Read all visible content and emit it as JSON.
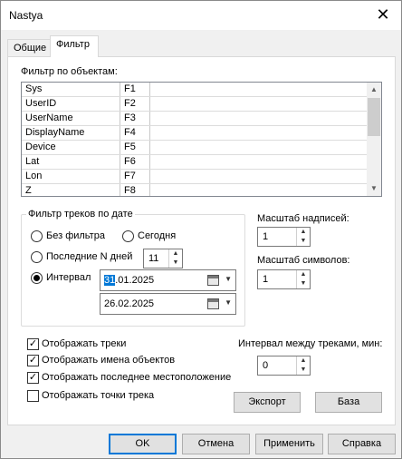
{
  "window": {
    "title": "Nastya",
    "close_glyph": "✕"
  },
  "tabs": [
    {
      "label": "Общие"
    },
    {
      "label": "Фильтр"
    }
  ],
  "object_filter": {
    "label": "Фильтр по объектам:",
    "rows": [
      {
        "name": "Sys",
        "key": "F1"
      },
      {
        "name": "UserID",
        "key": "F2"
      },
      {
        "name": "UserName",
        "key": "F3"
      },
      {
        "name": "DisplayName",
        "key": "F4"
      },
      {
        "name": "Device",
        "key": "F5"
      },
      {
        "name": "Lat",
        "key": "F6"
      },
      {
        "name": "Lon",
        "key": "F7"
      },
      {
        "name": "Z",
        "key": "F8"
      }
    ]
  },
  "date_filter": {
    "label": "Фильтр треков по дате",
    "no_filter_label": "Без фильтра",
    "today_label": "Сегодня",
    "last_n_label": "Последние N дней",
    "last_n_value": "11",
    "interval_label": "Интервал",
    "date_from_sel": "31",
    "date_from_rest": ".01.2025",
    "date_to": "26.02.2025",
    "selected": "interval"
  },
  "label_scale": {
    "label": "Масштаб надписей:",
    "value": "1"
  },
  "symbol_scale": {
    "label": "Масштаб символов:",
    "value": "1"
  },
  "track_interval": {
    "label": "Интервал между треками, мин:",
    "value": "0"
  },
  "options": [
    {
      "label": "Отображать треки",
      "checked": true
    },
    {
      "label": "Отображать имена объектов",
      "checked": true
    },
    {
      "label": "Отображать последнее местоположение",
      "checked": true
    },
    {
      "label": "Отображать точки трека",
      "checked": false
    }
  ],
  "check_glyph": "✓",
  "export_label": "Экспорт",
  "base_label": "База",
  "footer": {
    "ok": "OK",
    "cancel": "Отмена",
    "apply": "Применить",
    "help": "Справка"
  }
}
